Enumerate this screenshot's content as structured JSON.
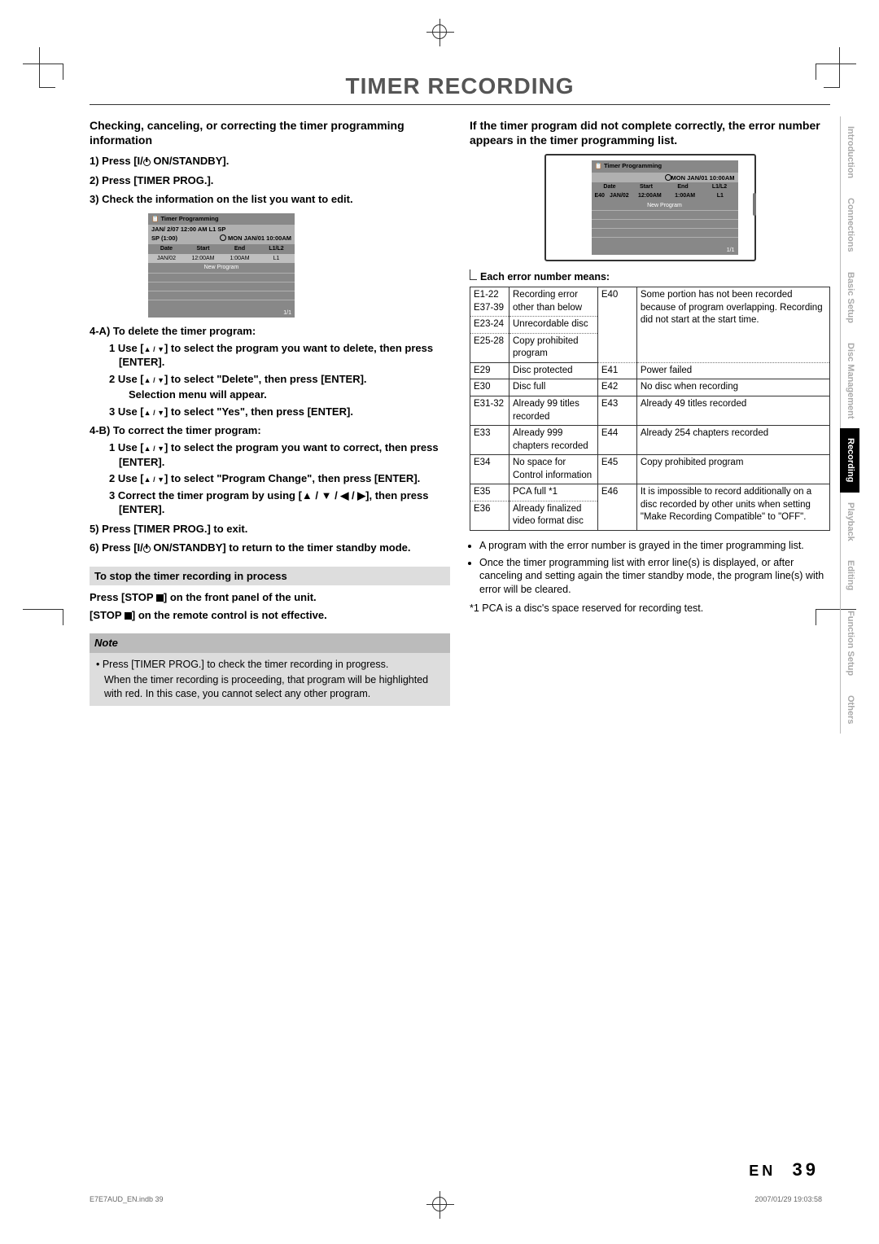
{
  "title": "TIMER RECORDING",
  "left": {
    "h_main": "Checking, canceling, or correcting the timer programming information",
    "s1": "1) Press [I/",
    "s1b": " ON/STANDBY].",
    "s2": "2) Press [TIMER PROG.].",
    "s3": "3) Check the information on the list you want to edit.",
    "s4a_head": "4-A) To delete the timer program:",
    "s4a_1a": "1 Use [",
    "s4a_1b": "] to select the program you want to delete, then press [ENTER].",
    "s4a_2a": "2 Use [",
    "s4a_2b": "] to select \"Delete\", then press [ENTER].",
    "s4a_2c": "Selection menu will appear.",
    "s4a_3a": "3 Use [",
    "s4a_3b": "] to select \"Yes\", then press [ENTER].",
    "s4b_head": "4-B) To correct the timer program:",
    "s4b_1a": "1 Use [",
    "s4b_1b": "] to select the program you want to correct, then press [ENTER].",
    "s4b_2a": "2 Use [",
    "s4b_2b": "] to select \"Program Change\", then press [ENTER].",
    "s4b_3": "3 Correct the timer program by using [▲ / ▼ / ◀ / ▶], then press [ENTER].",
    "s5": "5) Press [TIMER PROG.] to exit.",
    "s6a": "6) Press [I/",
    "s6b": " ON/STANDBY] to return to the timer standby mode.",
    "sub_stop": "To stop the timer recording in process",
    "stop1a": "Press [STOP ",
    "stop1b": "] on the front panel of the unit.",
    "stop2a": "[STOP ",
    "stop2b": "] on the remote control is not effective.",
    "note_title": "Note",
    "note_body1": "• Press [TIMER PROG.] to check the timer recording in progress.",
    "note_body2": "When the timer recording is proceeding, that program will be highlighted with red. In this case, you cannot select any other program."
  },
  "osd1": {
    "title": "Timer Programming",
    "line1": "JAN/ 2/07  12:00 AM     L1     SP",
    "line2a": "SP  (1:00)",
    "line2b": "MON JAN/01 10:00AM",
    "th": [
      "Date",
      "Start",
      "End",
      "L1/L2"
    ],
    "row": [
      "JAN/02",
      "12:00AM",
      "1:00AM",
      "L1"
    ],
    "newprog": "New Program",
    "foot": "1/1"
  },
  "right": {
    "h_main": "If the timer program did not complete correctly, the error number appears in the timer programming list.",
    "err_cap": "Each error number means:",
    "bul1": "A program with the error number is grayed in the timer programming list.",
    "bul2": "Once the timer programming list with error line(s) is displayed, or after canceling and setting again the timer standby mode, the program line(s) with error will be cleared.",
    "star": "*1 PCA is a disc's space reserved for recording test."
  },
  "osd2": {
    "title": "Timer Programming",
    "hdr": "MON JAN/01 10:00AM",
    "th": [
      "Date",
      "Start",
      "End",
      "L1/L2"
    ],
    "err": "E40",
    "row": [
      "JAN/02",
      "12:00AM",
      "1:00AM",
      "L1"
    ],
    "newprog": "New Program",
    "foot": "1/1"
  },
  "err_rows": [
    [
      "E1-22 E37-39",
      "Recording error other than below",
      "E40",
      "Some portion has not been recorded because of program overlapping. Recording did not start at the start time."
    ],
    [
      "E23-24",
      "Unrecordable disc",
      "",
      ""
    ],
    [
      "E25-28",
      "Copy prohibited program",
      "",
      ""
    ],
    [
      "E29",
      "Disc protected",
      "E41",
      "Power failed"
    ],
    [
      "E30",
      "Disc full",
      "E42",
      "No disc when recording"
    ],
    [
      "E31-32",
      "Already 99 titles recorded",
      "E43",
      "Already 49 titles recorded"
    ],
    [
      "E33",
      "Already 999 chapters recorded",
      "E44",
      "Already 254 chapters recorded"
    ],
    [
      "E34",
      "No space for Control information",
      "E45",
      "Copy prohibited program"
    ],
    [
      "E35",
      "PCA full *1",
      "E46",
      "It is impossible to record additionally on a disc recorded by other units when setting \"Make Recording Compatible\" to \"OFF\"."
    ],
    [
      "E36",
      "Already finalized video format disc",
      "",
      ""
    ]
  ],
  "tabs": [
    "Introduction",
    "Connections",
    "Basic Setup",
    "Disc Management",
    "Recording",
    "Playback",
    "Editing",
    "Function Setup",
    "Others"
  ],
  "active_tab": 4,
  "page_lang": "EN",
  "page_no": "39",
  "footer_left": "E7E7AUD_EN.indb   39",
  "footer_right": "2007/01/29   19:03:58"
}
